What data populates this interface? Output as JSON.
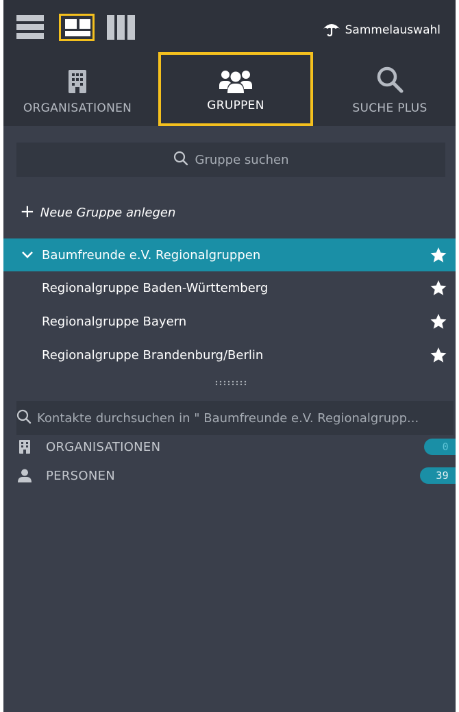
{
  "toolbar": {
    "sammelauswahl_label": "Sammelauswahl"
  },
  "tabs": [
    {
      "label": "ORGANISATIONEN",
      "icon": "building-icon"
    },
    {
      "label": "GRUPPEN",
      "icon": "users-icon",
      "active": true
    },
    {
      "label": "SUCHE PLUS",
      "icon": "search-icon"
    }
  ],
  "group_search": {
    "placeholder": "Gruppe suchen"
  },
  "new_group_label": "Neue Gruppe anlegen",
  "tree": {
    "parent": {
      "label": "Baumfreunde e.V. Regionalgruppen",
      "expanded": true,
      "selected": true
    },
    "children": [
      {
        "label": "Regionalgruppe Baden-Württemberg"
      },
      {
        "label": "Regionalgruppe Bayern"
      },
      {
        "label": "Regionalgruppe Brandenburg/Berlin"
      }
    ]
  },
  "contact_search": {
    "placeholder": "Kontakte durchsuchen in \" Baumfreunde e.V. Regionalgrupp..."
  },
  "categories": [
    {
      "label": "ORGANISATIONEN",
      "count": "0",
      "icon": "building-icon"
    },
    {
      "label": "PERSONEN",
      "count": "39",
      "icon": "person-icon"
    }
  ],
  "colors": {
    "panel_bg": "#3a3f4b",
    "topbar_bg": "#2e323b",
    "accent": "#1a8fa6",
    "highlight_border": "#f4c01e"
  }
}
